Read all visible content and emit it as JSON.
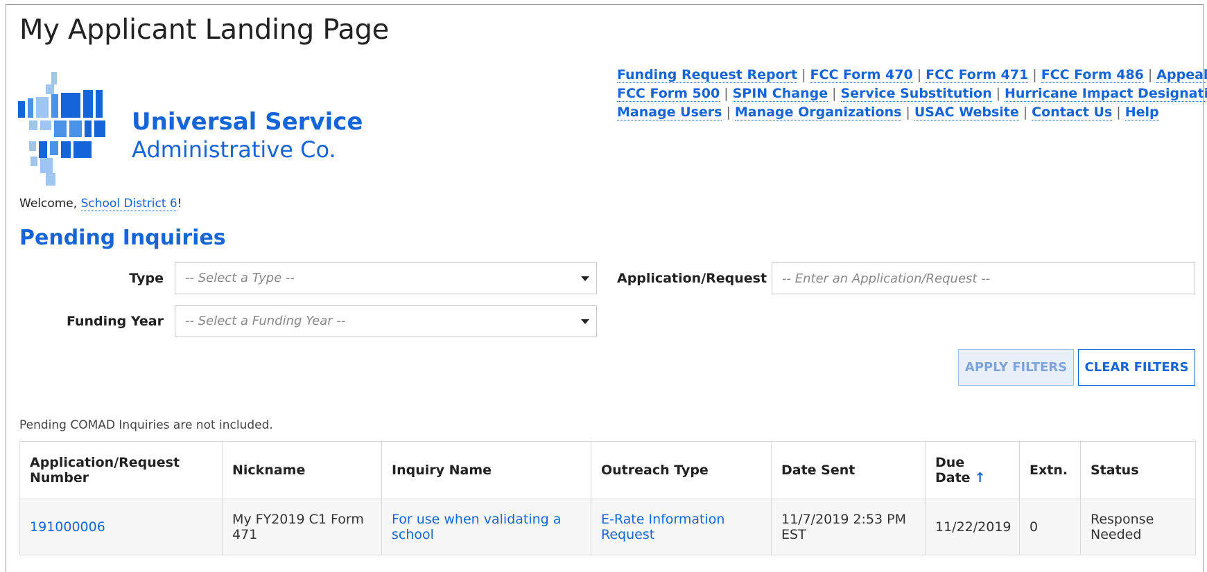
{
  "page": {
    "title": "My Applicant Landing Page"
  },
  "logo": {
    "line1": "Universal Service",
    "line2": "Administrative Co."
  },
  "nav": {
    "links": [
      "Funding Request Report",
      "FCC Form 470",
      "FCC Form 471",
      "FCC Form 486",
      "Appeal",
      "FCC Form 500",
      "SPIN Change",
      "Service Substitution",
      "Hurricane Impact Designation",
      "Manage Users",
      "Manage Organizations",
      "USAC Website",
      "Contact Us",
      "Help"
    ],
    "separator": "|"
  },
  "welcome": {
    "prefix": "Welcome, ",
    "user": "School District 6",
    "suffix": "!"
  },
  "section": {
    "title": "Pending Inquiries"
  },
  "filters": {
    "type_label": "Type",
    "type_placeholder": "-- Select a Type --",
    "funding_year_label": "Funding Year",
    "funding_year_placeholder": "-- Select a Funding Year --",
    "application_label": "Application/Request",
    "application_placeholder": "-- Enter an Application/Request --",
    "apply_label": "APPLY FILTERS",
    "clear_label": "CLEAR FILTERS"
  },
  "note": "Pending COMAD Inquiries are not included.",
  "table": {
    "columns": [
      "Application/Request Number",
      "Nickname",
      "Inquiry Name",
      "Outreach Type",
      "Date Sent",
      "Due Date",
      "Extn.",
      "Status"
    ],
    "sort_indicator": "↑",
    "rows": [
      {
        "application_number": "191000006",
        "nickname": "My FY2019 C1 Form 471",
        "inquiry_name": "For use when validating a school",
        "outreach_type": "E-Rate Information Request",
        "date_sent": "11/7/2019 2:53 PM EST",
        "due_date": "11/22/2019",
        "extn": "0",
        "status": "Response Needed"
      }
    ]
  },
  "colors": {
    "accent": "#1565d8",
    "logo_light": "#9ec6f0",
    "logo_mid": "#4a93e8",
    "logo_dark": "#1565d8"
  }
}
